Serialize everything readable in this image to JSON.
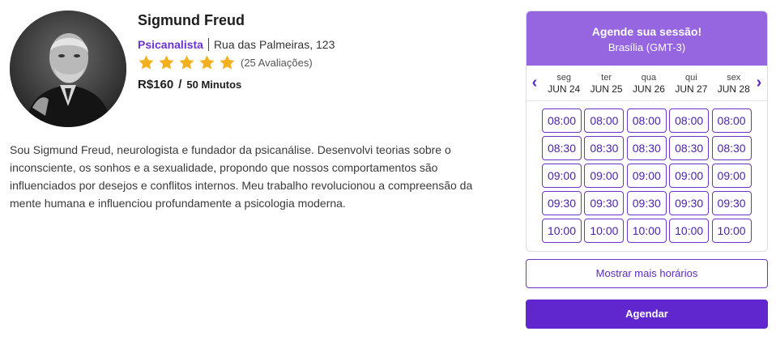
{
  "profile": {
    "name": "Sigmund Freud",
    "specialty": "Psicanalista",
    "address": "Rua das Palmeiras, 123",
    "rating_stars": 5,
    "reviews": "(25 Avaliações)",
    "price": "R$160",
    "price_separator": "/",
    "duration": "50 Minutos",
    "bio": "Sou Sigmund Freud, neurologista e fundador da psicanálise. Desenvolvi teorias sobre o inconsciente, os sonhos e a sexualidade, propondo que nossos comportamentos são influenciados por desejos e conflitos internos. Meu trabalho revolucionou a compreensão da mente humana e influenciou profundamente a psicologia moderna."
  },
  "booking": {
    "title": "Agende sua sessão!",
    "timezone": "Brasília (GMT-3)",
    "prev_icon": "chevron-left-icon",
    "next_icon": "chevron-right-icon",
    "days": [
      {
        "name": "seg",
        "date": "JUN 24"
      },
      {
        "name": "ter",
        "date": "JUN 25"
      },
      {
        "name": "qua",
        "date": "JUN 26"
      },
      {
        "name": "qui",
        "date": "JUN 27"
      },
      {
        "name": "sex",
        "date": "JUN 28"
      }
    ],
    "times": [
      "08:00",
      "08:30",
      "09:00",
      "09:30",
      "10:00"
    ],
    "more_label": "Mostrar mais horários",
    "book_label": "Agendar"
  },
  "colors": {
    "accent": "#5f27cd",
    "header": "#9566e0",
    "star": "#f2b01e",
    "specialty": "#6a35c9"
  }
}
